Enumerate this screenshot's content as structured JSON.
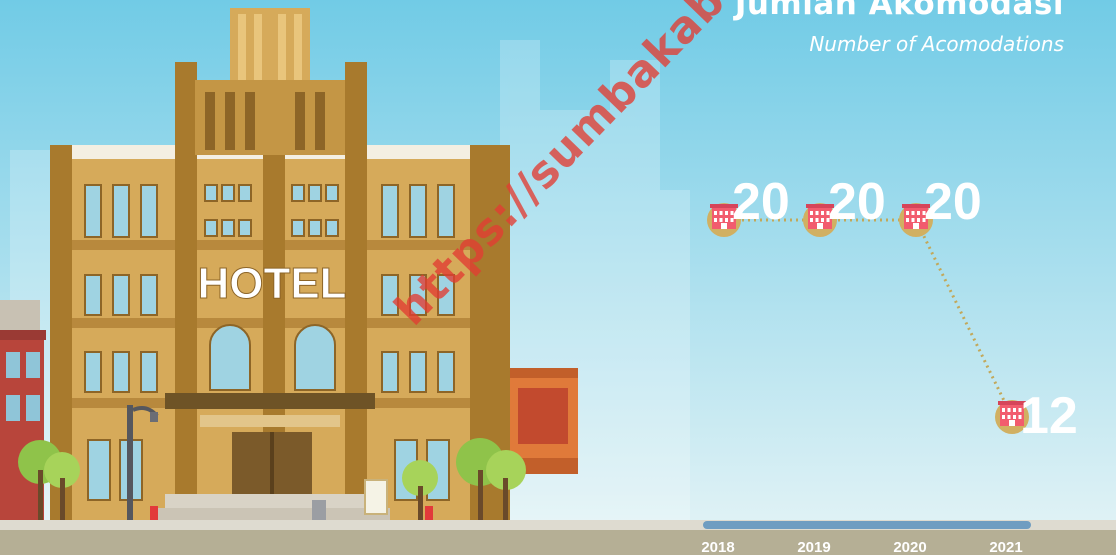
{
  "header": {
    "title": "Jumlah Akomodasi",
    "subtitle": "Number of Acomodations"
  },
  "hotel_sign": "HOTEL",
  "watermark": "https://sumbakab.bps.go.id",
  "colors": {
    "sky_top": "#71cbe6",
    "sky_bottom": "#e6f4f6",
    "building": "#d6aa5a",
    "building_dark": "#a87a2d",
    "connector": "#c2a85a",
    "marker_circle": "#d1b062",
    "hotel_icon": "#f25c6e",
    "road": "#b5af95",
    "slider": "#6f9dc1"
  },
  "chart_data": {
    "type": "line",
    "title": "Jumlah Akomodasi",
    "subtitle": "Number of Acomodations",
    "categories": [
      "2018",
      "2019",
      "2020",
      "2021"
    ],
    "series": [
      {
        "values": [
          20,
          20,
          20,
          12
        ],
        "data_labels": [
          "20",
          "20",
          "20",
          "12"
        ],
        "marker": "hotel-icon"
      }
    ],
    "grid": false,
    "legend": "none"
  }
}
